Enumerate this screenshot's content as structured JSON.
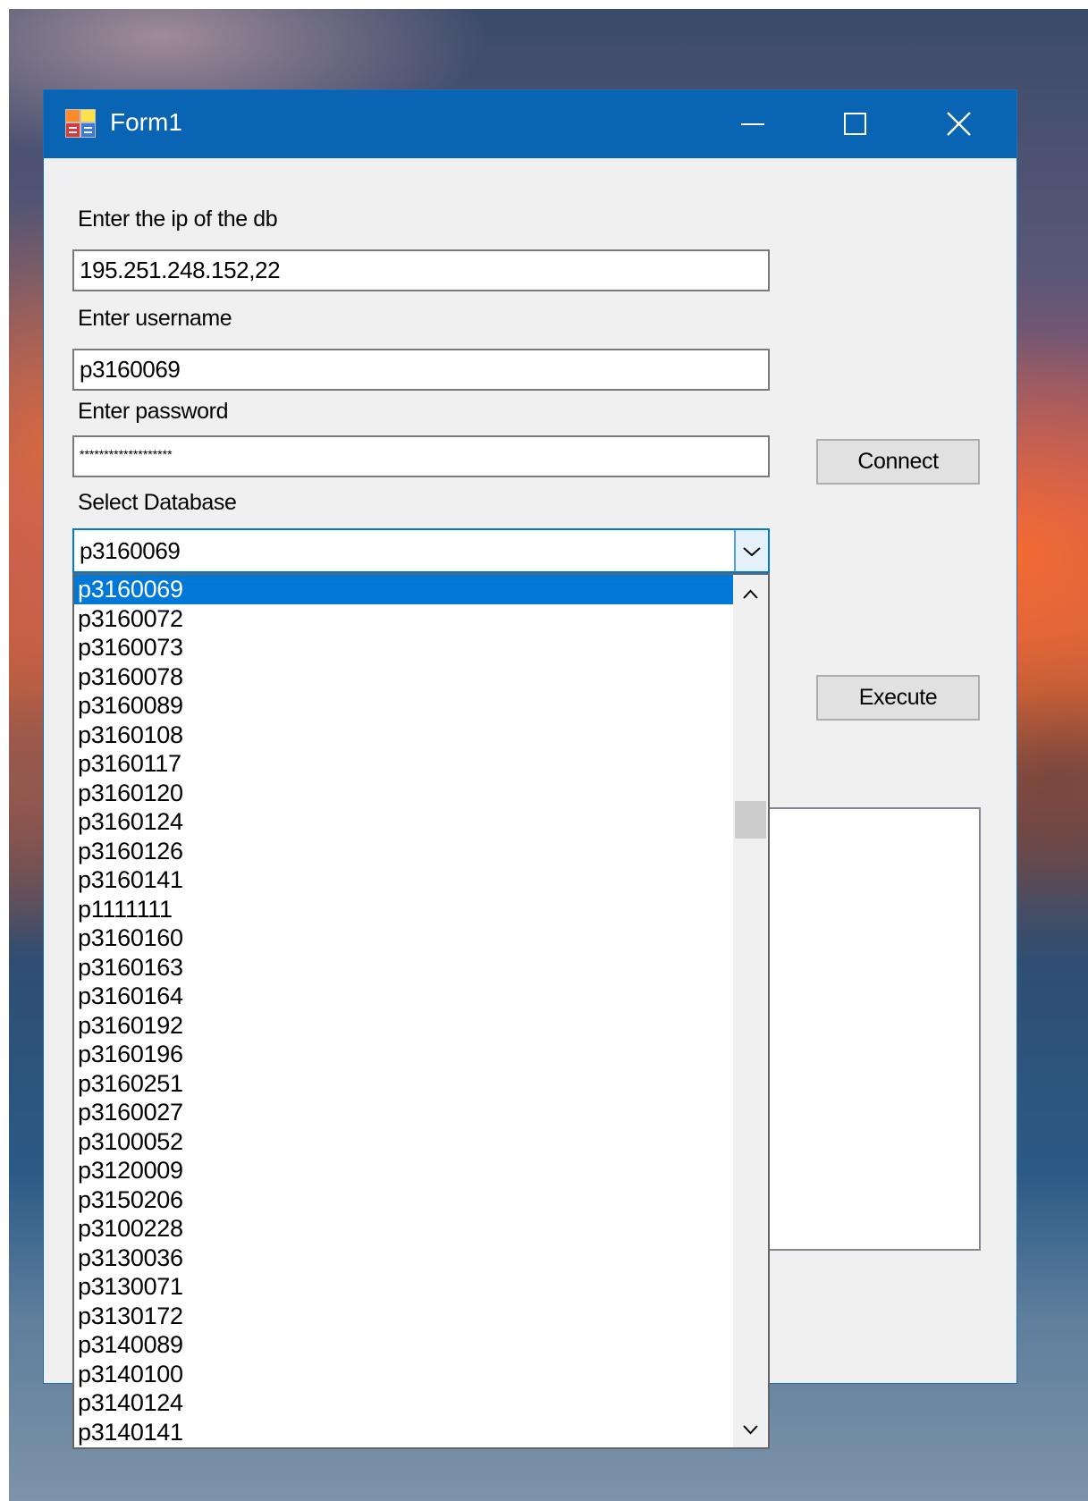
{
  "window": {
    "title": "Form1",
    "icon": "windows-form-icon",
    "controls": {
      "minimize": "minimize-icon",
      "maximize": "maximize-icon",
      "close": "close-icon"
    }
  },
  "form": {
    "ip_label": "Enter the ip of the db",
    "ip_value": "195.251.248.152,22",
    "username_label": "Enter username",
    "username_value": "p3160069",
    "password_label": "Enter password",
    "password_value": "*******************",
    "connect_button": "Connect",
    "database_label": "Select Database",
    "database_selected": "p3160069",
    "execute_button": "Execute"
  },
  "dropdown": {
    "selected_index": 0,
    "items": [
      "p3160069",
      "p3160072",
      "p3160073",
      "p3160078",
      "p3160089",
      "p3160108",
      "p3160117",
      "p3160120",
      "p3160124",
      "p3160126",
      "p3160141",
      "p1111111",
      "p3160160",
      "p3160163",
      "p3160164",
      "p3160192",
      "p3160196",
      "p3160251",
      "p3160027",
      "p3100052",
      "p3120009",
      "p3150206",
      "p3100228",
      "p3130036",
      "p3130071",
      "p3130172",
      "p3140089",
      "p3140100",
      "p3140124",
      "p3140141"
    ]
  },
  "colors": {
    "titlebar": "#0a64b4",
    "selection": "#0078d7",
    "window_bg": "#f0f0f0"
  }
}
